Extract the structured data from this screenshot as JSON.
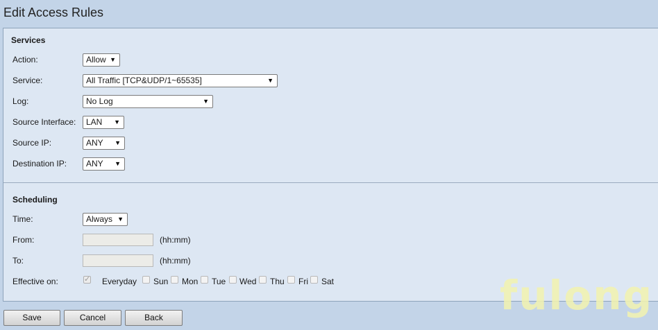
{
  "page": {
    "title": "Edit Access Rules"
  },
  "services": {
    "heading": "Services",
    "action": {
      "label": "Action:",
      "value": "Allow"
    },
    "service": {
      "label": "Service:",
      "value": "All Traffic [TCP&UDP/1~65535]"
    },
    "log": {
      "label": "Log:",
      "value": "No Log"
    },
    "source_interface": {
      "label": "Source Interface:",
      "value": "LAN"
    },
    "source_ip": {
      "label": "Source IP:",
      "value": "ANY"
    },
    "destination_ip": {
      "label": "Destination IP:",
      "value": "ANY"
    }
  },
  "scheduling": {
    "heading": "Scheduling",
    "time": {
      "label": "Time:",
      "value": "Always"
    },
    "from": {
      "label": "From:",
      "value": "",
      "hint": "(hh:mm)"
    },
    "to": {
      "label": "To:",
      "value": "",
      "hint": "(hh:mm)"
    },
    "effective_on": {
      "label": "Effective on:",
      "days": [
        {
          "label": "Everyday",
          "checked": true
        },
        {
          "label": "Sun",
          "checked": false
        },
        {
          "label": "Mon",
          "checked": false
        },
        {
          "label": "Tue",
          "checked": false
        },
        {
          "label": "Wed",
          "checked": false
        },
        {
          "label": "Thu",
          "checked": false
        },
        {
          "label": "Fri",
          "checked": false
        },
        {
          "label": "Sat",
          "checked": false
        }
      ]
    }
  },
  "buttons": {
    "save": "Save",
    "cancel": "Cancel",
    "back": "Back"
  },
  "watermark": "fulong",
  "icons": {
    "dropdown": "dropdown-arrow-icon",
    "checkbox_check": "checkmark-icon"
  }
}
